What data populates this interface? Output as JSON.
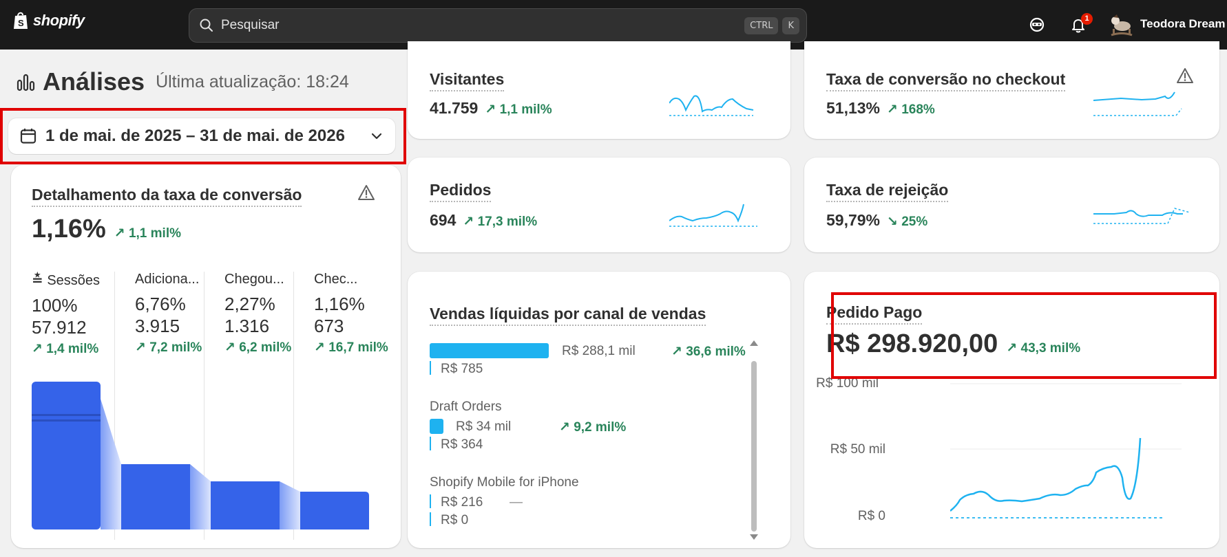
{
  "topbar": {
    "logo_text": "shopify",
    "search_placeholder": "Pesquisar",
    "shortcut_ctrl": "CTRL",
    "shortcut_k": "K",
    "notification_count": "1",
    "user_name": "Teodora Dream"
  },
  "header": {
    "title": "Análises",
    "last_updated": "Última atualização: 18:24",
    "date_range": "1 de mai. de 2025 – 31 de mai. de 2026"
  },
  "conversion": {
    "title": "Detalhamento da taxa de conversão",
    "value": "1,16%",
    "delta": "1,1 mil%",
    "columns": [
      {
        "label": "Sessões",
        "pct": "100%",
        "count": "57.912",
        "delta": "1,4 mil%"
      },
      {
        "label": "Adiciona...",
        "pct": "6,76%",
        "count": "3.915",
        "delta": "7,2 mil%"
      },
      {
        "label": "Chegou...",
        "pct": "2,27%",
        "count": "1.316",
        "delta": "6,2 mil%"
      },
      {
        "label": "Chec...",
        "pct": "1,16%",
        "count": "673",
        "delta": "16,7 mil%"
      }
    ]
  },
  "visitors": {
    "title": "Visitantes",
    "value": "41.759",
    "delta": "1,1 mil%"
  },
  "orders": {
    "title": "Pedidos",
    "value": "694",
    "delta": "17,3 mil%"
  },
  "checkout_conversion": {
    "title": "Taxa de conversão no checkout",
    "value": "51,13%",
    "delta": "168%"
  },
  "bounce": {
    "title": "Taxa de rejeição",
    "value": "59,79%",
    "delta": "25%"
  },
  "sales_channel": {
    "title": "Vendas líquidas por canal de vendas",
    "rows": [
      {
        "name": "",
        "current": "R$ 288,1 mil",
        "previous": "R$ 785",
        "delta": "36,6 mil%",
        "fraction": 1.0
      },
      {
        "name": "Draft Orders",
        "current": "R$ 34 mil",
        "previous": "R$ 364",
        "delta": "9,2 mil%",
        "fraction": 0.118
      },
      {
        "name": "Shopify Mobile for iPhone",
        "current": "R$ 216",
        "previous": "R$ 0",
        "delta": "—",
        "fraction": 0.001
      }
    ]
  },
  "paid_orders": {
    "title": "Pedido Pago",
    "value": "R$ 298.920,00",
    "delta": "43,3 mil%",
    "y_labels": [
      "R$ 100 mil",
      "R$ 50 mil",
      "R$ 0"
    ]
  },
  "colors": {
    "accent_green": "#29845a",
    "series_blue": "#1eb2f0",
    "funnel_blue": "#3563e9",
    "highlight_red": "#e00000"
  }
}
